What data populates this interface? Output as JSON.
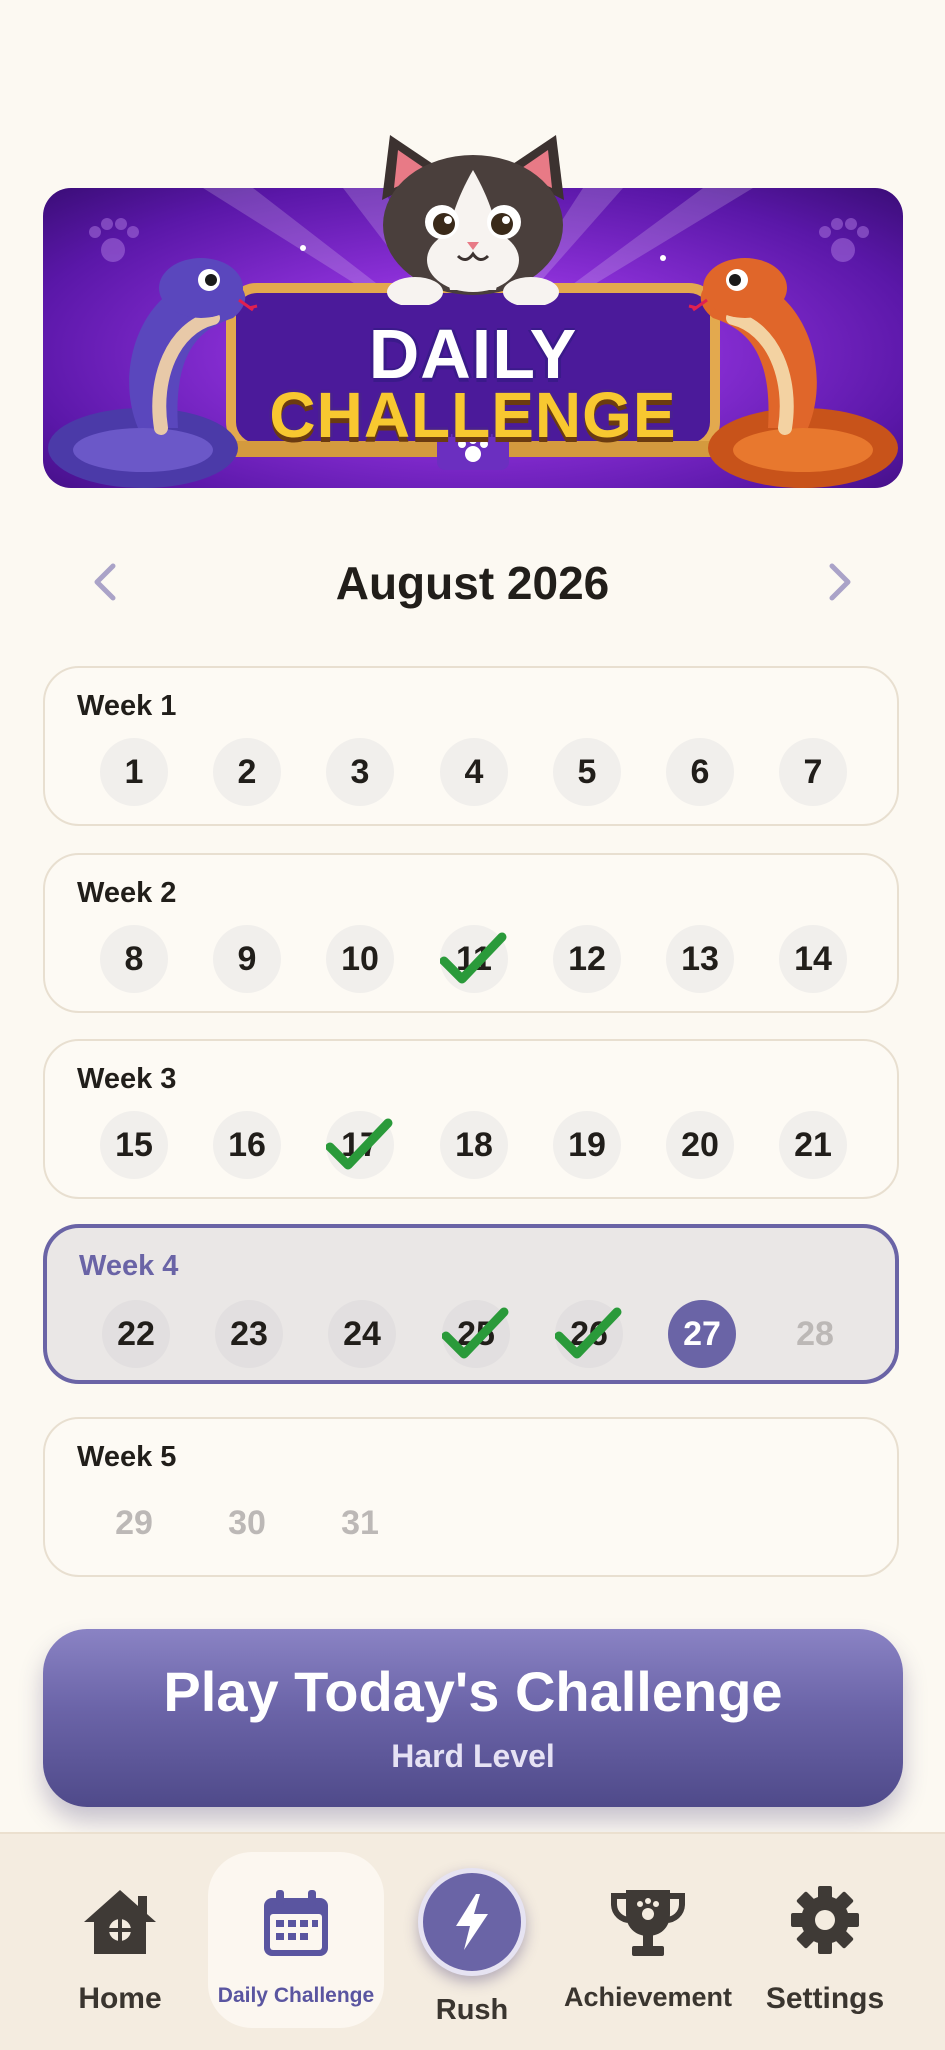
{
  "banner": {
    "line1": "DAILY",
    "line2": "CHALLENGE"
  },
  "calendar": {
    "month": "August 2026",
    "prev_icon": "chevron-left-icon",
    "next_icon": "chevron-right-icon",
    "weeks": [
      {
        "label": "Week 1",
        "days": [
          {
            "n": "1",
            "state": "normal"
          },
          {
            "n": "2",
            "state": "normal"
          },
          {
            "n": "3",
            "state": "normal"
          },
          {
            "n": "4",
            "state": "normal"
          },
          {
            "n": "5",
            "state": "normal"
          },
          {
            "n": "6",
            "state": "normal"
          },
          {
            "n": "7",
            "state": "normal"
          }
        ]
      },
      {
        "label": "Week 2",
        "days": [
          {
            "n": "8",
            "state": "normal"
          },
          {
            "n": "9",
            "state": "normal"
          },
          {
            "n": "10",
            "state": "normal"
          },
          {
            "n": "11",
            "state": "completed"
          },
          {
            "n": "12",
            "state": "normal"
          },
          {
            "n": "13",
            "state": "normal"
          },
          {
            "n": "14",
            "state": "normal"
          }
        ]
      },
      {
        "label": "Week 3",
        "days": [
          {
            "n": "15",
            "state": "normal"
          },
          {
            "n": "16",
            "state": "normal"
          },
          {
            "n": "17",
            "state": "completed"
          },
          {
            "n": "18",
            "state": "normal"
          },
          {
            "n": "19",
            "state": "normal"
          },
          {
            "n": "20",
            "state": "normal"
          },
          {
            "n": "21",
            "state": "normal"
          }
        ]
      },
      {
        "label": "Week 4",
        "current": true,
        "days": [
          {
            "n": "22",
            "state": "normal"
          },
          {
            "n": "23",
            "state": "normal"
          },
          {
            "n": "24",
            "state": "normal"
          },
          {
            "n": "25",
            "state": "completed"
          },
          {
            "n": "26",
            "state": "completed"
          },
          {
            "n": "27",
            "state": "today"
          },
          {
            "n": "28",
            "state": "future"
          }
        ]
      },
      {
        "label": "Week 5",
        "days": [
          {
            "n": "29",
            "state": "future"
          },
          {
            "n": "30",
            "state": "future"
          },
          {
            "n": "31",
            "state": "future"
          }
        ]
      }
    ]
  },
  "play_button": {
    "title": "Play Today's Challenge",
    "subtitle": "Hard Level"
  },
  "bottom_nav": {
    "items": [
      {
        "label": "Home",
        "icon": "home-icon"
      },
      {
        "label": "Daily Challenge",
        "icon": "calendar-icon",
        "active": true
      },
      {
        "label": "Rush",
        "icon": "lightning-icon"
      },
      {
        "label": "Achievement",
        "icon": "trophy-icon"
      },
      {
        "label": "Settings",
        "icon": "gear-icon"
      }
    ]
  },
  "colors": {
    "accent": "#6a64a6",
    "check": "#2a9a3a",
    "background": "#fcf9f2"
  }
}
